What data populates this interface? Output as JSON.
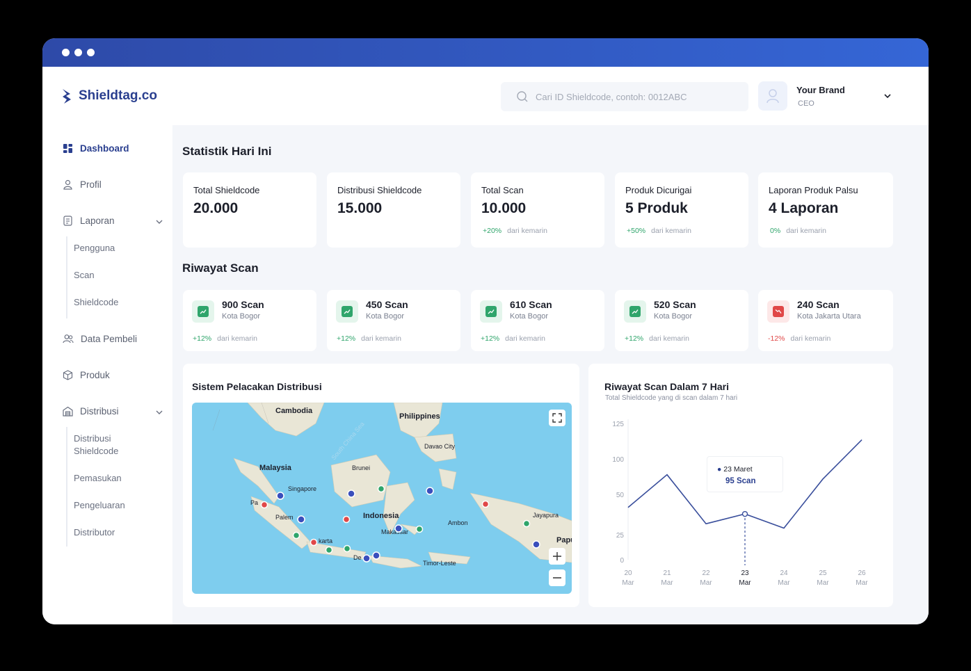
{
  "brand": {
    "name": "Shieldtag.co"
  },
  "search": {
    "placeholder": "Cari ID Shieldcode, contoh: 0012ABC"
  },
  "user": {
    "name": "Your Brand",
    "role": "CEO"
  },
  "sidebar": {
    "items": [
      {
        "label": "Dashboard",
        "icon": "grid-icon",
        "active": true
      },
      {
        "label": "Profil",
        "icon": "user-icon"
      },
      {
        "label": "Laporan",
        "icon": "document-icon"
      },
      {
        "label": "Data Pembeli",
        "icon": "users-icon"
      },
      {
        "label": "Produk",
        "icon": "box-icon"
      },
      {
        "label": "Distribusi",
        "icon": "warehouse-icon"
      }
    ],
    "laporan_sub": [
      "Pengguna",
      "Scan",
      "Shieldcode"
    ],
    "distribusi_sub": [
      "Distribusi Shieldcode",
      "Pemasukan",
      "Pengeluaran",
      "Distributor"
    ]
  },
  "stats": {
    "title": "Statistik Hari Ini",
    "cards": [
      {
        "label": "Total Shieldcode",
        "value": "20.000",
        "change": "",
        "foot": ""
      },
      {
        "label": "Distribusi Shieldcode",
        "value": "15.000",
        "change": "",
        "foot": ""
      },
      {
        "label": "Total Scan",
        "value": "10.000",
        "change": "+20%",
        "foot": "dari kemarin"
      },
      {
        "label": "Produk Dicurigai",
        "value": "5 Produk",
        "change": "+50%",
        "foot": "dari kemarin"
      },
      {
        "label": "Laporan Produk Palsu",
        "value": "4 Laporan",
        "change": "0%",
        "foot": "dari kemarin"
      }
    ]
  },
  "scans": {
    "title": "Riwayat Scan",
    "cards": [
      {
        "value": "900 Scan",
        "city": "Kota Bogor",
        "change": "+12%",
        "foot": "dari kemarin",
        "trend": "up"
      },
      {
        "value": "450 Scan",
        "city": "Kota Bogor",
        "change": "+12%",
        "foot": "dari kemarin",
        "trend": "up"
      },
      {
        "value": "610 Scan",
        "city": "Kota Bogor",
        "change": "+12%",
        "foot": "dari kemarin",
        "trend": "up"
      },
      {
        "value": "520 Scan",
        "city": "Kota Bogor",
        "change": "+12%",
        "foot": "dari kemarin",
        "trend": "up"
      },
      {
        "value": "240 Scan",
        "city": "Kota Jakarta Utara",
        "change": "-12%",
        "foot": "dari kemarin",
        "trend": "down"
      }
    ]
  },
  "map_panel": {
    "title": "Sistem Pelacakan Distribusi",
    "labels": [
      "Cambodia",
      "Philippines",
      "Davao City",
      "Malaysia",
      "Brunei",
      "Singapore",
      "Pa",
      "Palem",
      "Indonesia",
      "Makassar",
      "Ambon",
      "Jayapura",
      "Papu",
      "karta",
      "De",
      "Timor-Leste",
      "South China Sea"
    ]
  },
  "chart_panel": {
    "title": "Riwayat Scan Dalam 7 Hari",
    "subtitle": "Total Shieldcode yang di scan dalam 7 hari",
    "tooltip": {
      "date": "23 Maret",
      "value": "95 Scan"
    }
  },
  "chart_data": {
    "type": "line",
    "categories": [
      "20 Mar",
      "21 Mar",
      "22 Mar",
      "23 Mar",
      "24 Mar",
      "25 Mar",
      "26 Mar"
    ],
    "values": [
      48,
      78,
      33,
      42,
      29,
      74,
      110
    ],
    "yticks": [
      "125",
      "100",
      "50",
      "25",
      "0"
    ],
    "highlight_index": 3,
    "colors": {
      "line": "#3a4f9c",
      "accent": "#2a3f8f"
    }
  }
}
